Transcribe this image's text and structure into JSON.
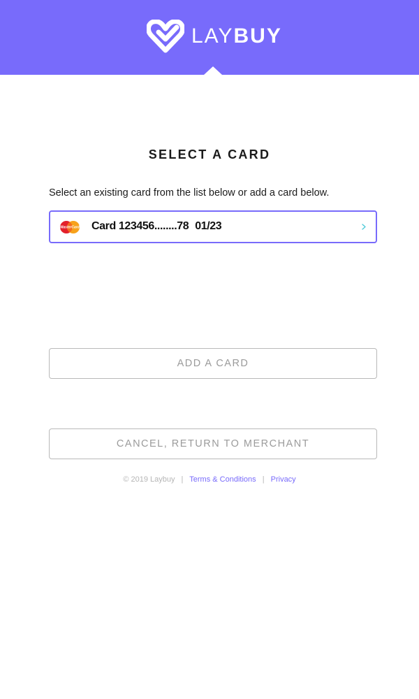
{
  "header": {
    "brand_light": "LAY",
    "brand_bold": "BUY",
    "background_color": "#786bfb",
    "logo_icon": "heart-check-icon"
  },
  "main": {
    "title": "SELECT A CARD",
    "subtitle": "Select an existing card from the list below or add a card below.",
    "cards": [
      {
        "brand_icon": "mastercard-icon",
        "brand_text": "MasterCard",
        "label": "Card 123456........78",
        "expiry": "01/23",
        "selected": true
      }
    ],
    "add_card_label": "ADD A CARD",
    "cancel_label": "CANCEL, RETURN TO MERCHANT"
  },
  "footer": {
    "copyright": "© 2019 Laybuy",
    "separator": "|",
    "terms_label": "Terms & Conditions",
    "privacy_label": "Privacy"
  },
  "colors": {
    "accent": "#786bfb",
    "chevron": "#4ac9d8",
    "button_border": "#b9b9b9",
    "button_text": "#9b9b9b"
  }
}
